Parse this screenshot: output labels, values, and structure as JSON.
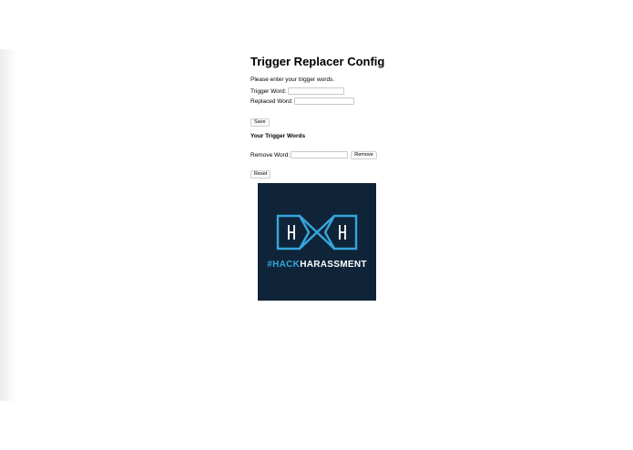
{
  "config": {
    "title": "Trigger Replacer Config",
    "instructions": "Please enter your trigger words.",
    "trigger_word_label": "Trigger Word:",
    "trigger_word_value": "",
    "replaced_word_label": "Replaced Word:",
    "replaced_word_value": "",
    "save_label": "Save",
    "list_heading": "Your Trigger Words",
    "remove_word_label": "Remove Word:",
    "remove_word_value": "",
    "remove_label": "Remove",
    "reset_label": "Reset"
  },
  "logo": {
    "text": "#HACKHARASSMENT",
    "colors": {
      "background": "#0f2438",
      "accent": "#35a6dc",
      "text_white": "#ffffff"
    }
  }
}
